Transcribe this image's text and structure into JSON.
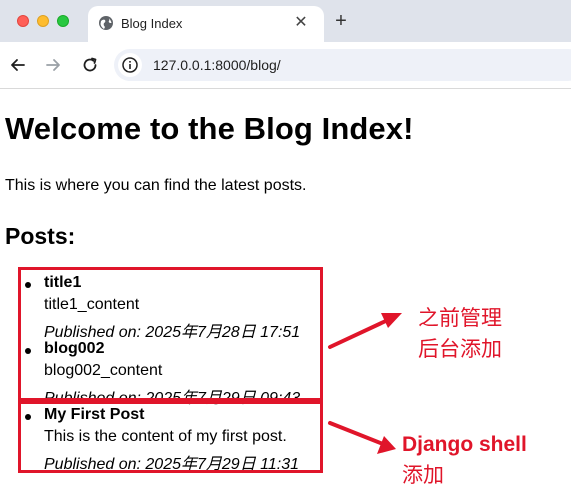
{
  "browser": {
    "tab_title": "Blog Index",
    "tab_close": "✕",
    "new_tab": "+",
    "url": "127.0.0.1:8000/blog/"
  },
  "page": {
    "heading": "Welcome to the Blog Index!",
    "intro": "This is where you can find the latest posts.",
    "posts_heading": "Posts:",
    "posts": [
      {
        "title": "title1",
        "content": "title1_content",
        "published": "Published on: 2025年7月28日 17:51"
      },
      {
        "title": "blog002",
        "content": "blog002_content",
        "published": "Published on: 2025年7月29日 09:43"
      },
      {
        "title": "My First Post",
        "content": "This is the content of my first post.",
        "published": "Published on: 2025年7月29日 11:31"
      }
    ]
  },
  "annotations": {
    "admin_line1": "之前管理",
    "admin_line2": "后台添加",
    "shell_line1": "Django shell",
    "shell_line2": "添加",
    "color": "#e0152a"
  }
}
